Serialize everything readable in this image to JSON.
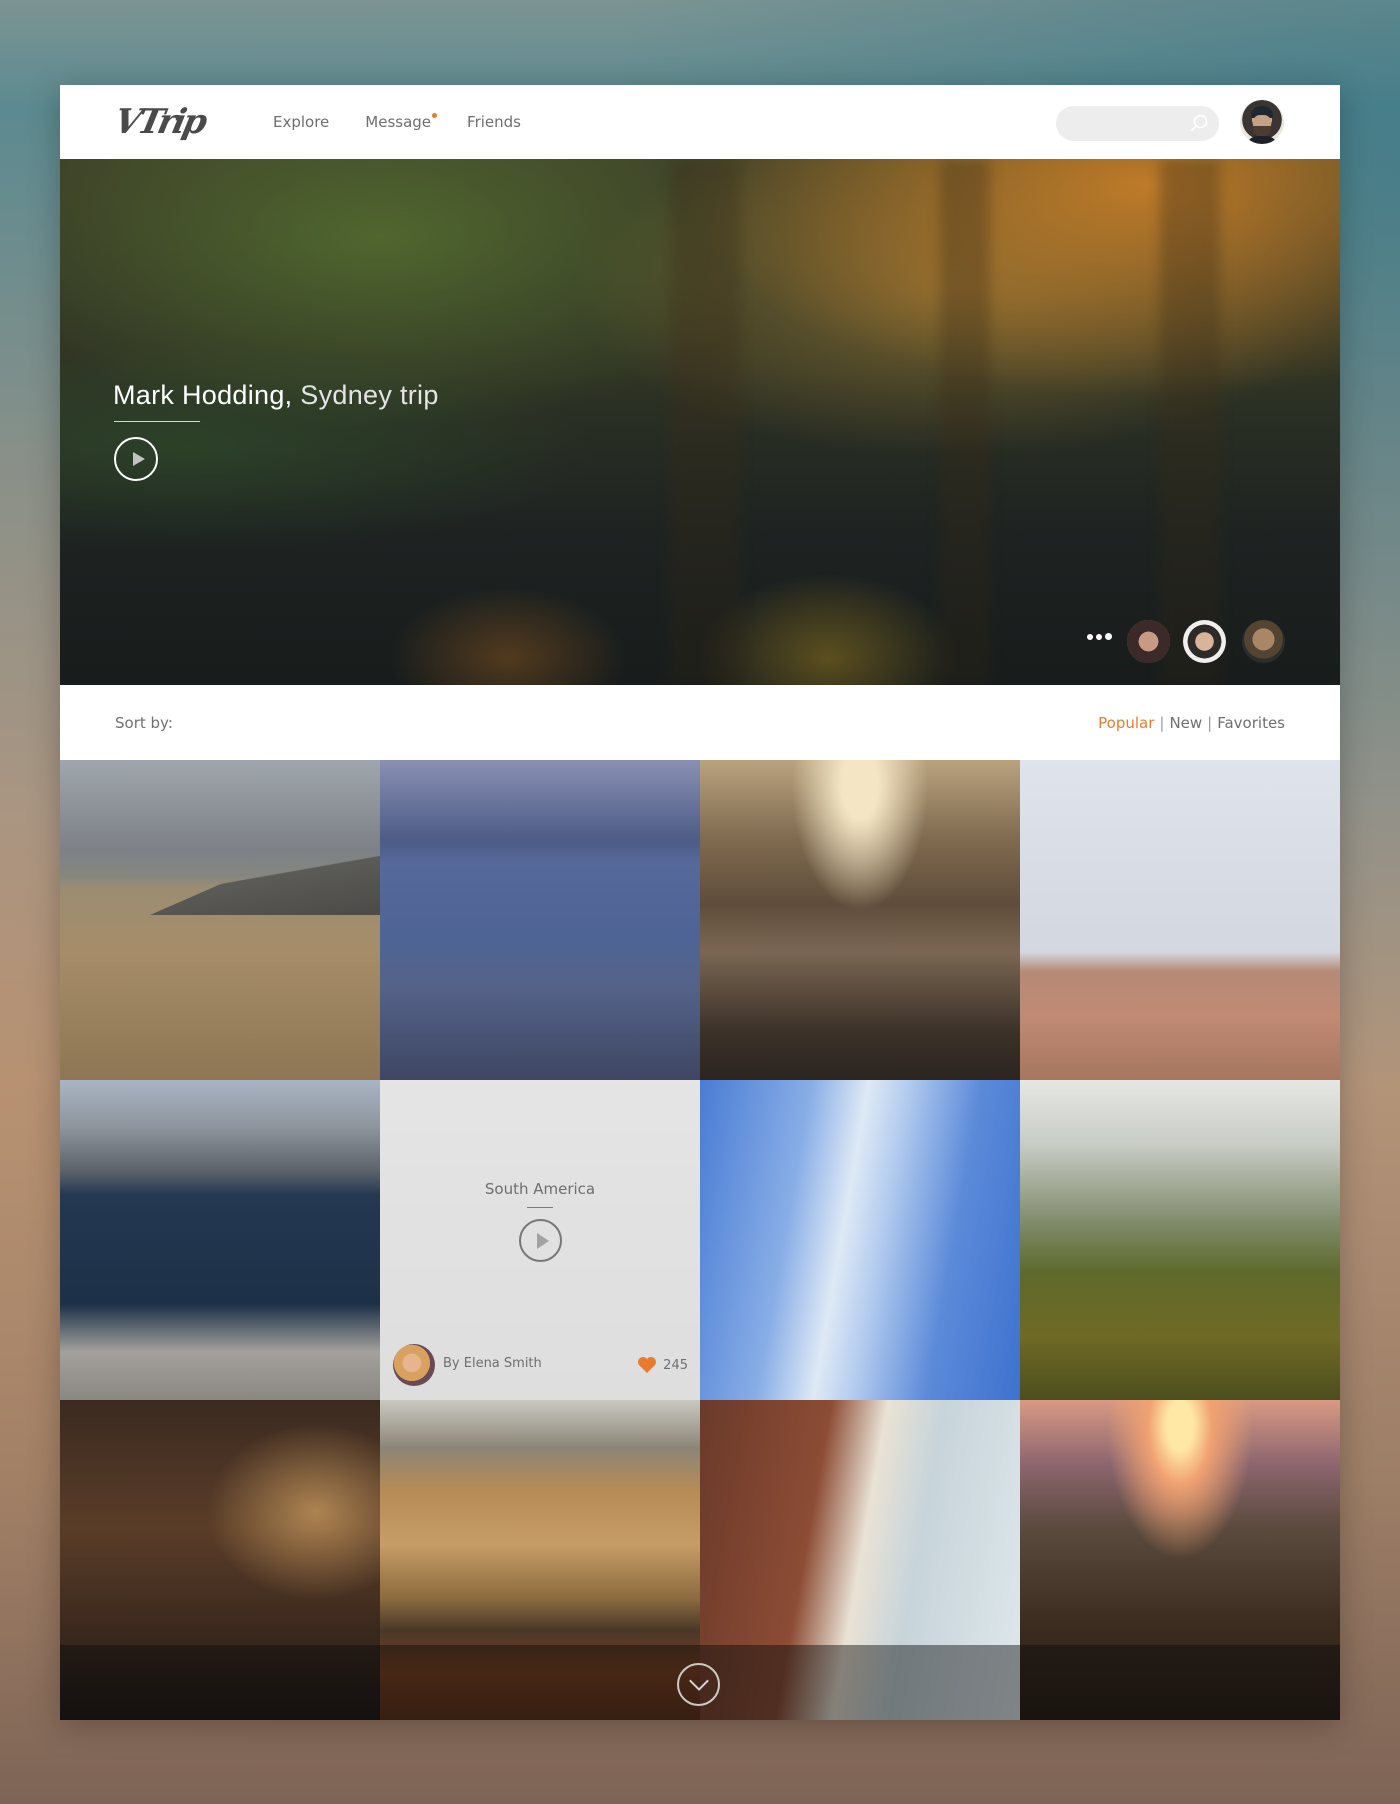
{
  "header": {
    "logo": "VTrip",
    "nav": [
      {
        "label": "Explore",
        "has_notification": false
      },
      {
        "label": "Message",
        "has_notification": true
      },
      {
        "label": "Friends",
        "has_notification": false
      }
    ],
    "search": {
      "placeholder": "",
      "value": "",
      "icon": "search-icon"
    },
    "user_avatar": "user-avatar"
  },
  "hero": {
    "author": "Mark Hodding,",
    "location": "Sydney trip",
    "play_icon": "play-icon",
    "more_icon": "more-dots-icon",
    "friends": [
      "friend-avatar-1",
      "friend-avatar-2",
      "friend-avatar-3"
    ]
  },
  "sort": {
    "label": "Sort by:",
    "options": [
      {
        "label": "Popular",
        "active": true
      },
      {
        "label": "New",
        "active": false
      },
      {
        "label": "Favorites",
        "active": false
      }
    ],
    "separator": "|"
  },
  "grid": {
    "tiles": [
      {
        "id": 1,
        "subject": "beach-with-mountains"
      },
      {
        "id": 2,
        "subject": "woman-by-lake-at-dusk"
      },
      {
        "id": 3,
        "subject": "misty-palm-valley-sunrise"
      },
      {
        "id": 4,
        "subject": "boats-on-shore"
      },
      {
        "id": 5,
        "subject": "woman-sitting-by-sea-city"
      },
      {
        "id": 6,
        "subject": "city-street-with-car",
        "hovered": true,
        "title": "South America",
        "author": "By Elena Smith",
        "likes": "245"
      },
      {
        "id": 7,
        "subject": "geyser-blue-sky"
      },
      {
        "id": 8,
        "subject": "foggy-green-hills"
      },
      {
        "id": 9,
        "subject": "people-by-fountain-night"
      },
      {
        "id": 10,
        "subject": "golden-plains-red-car"
      },
      {
        "id": 11,
        "subject": "rock-arch-beach"
      },
      {
        "id": 12,
        "subject": "person-at-sunset"
      }
    ],
    "scroll_icon": "chevron-down-icon"
  },
  "colors": {
    "accent": "#e87b2e",
    "text_muted": "#707070",
    "search_bg": "#ededed"
  }
}
